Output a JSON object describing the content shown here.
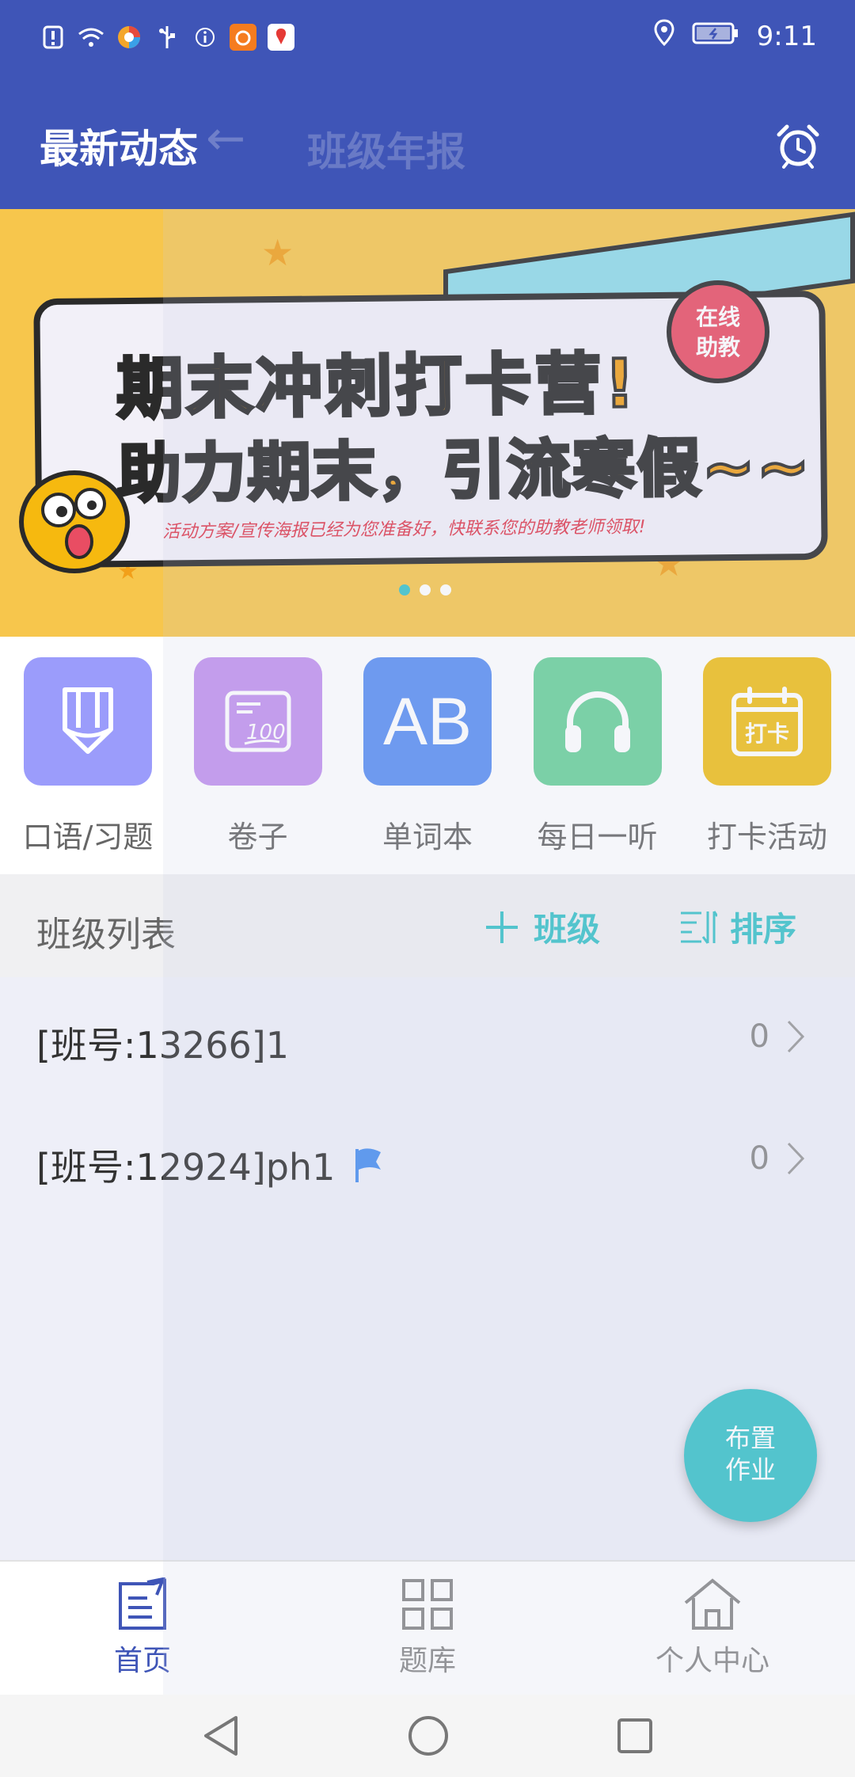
{
  "status_bar": {
    "time": "9:11",
    "left_icons": [
      "alert-icon",
      "wifi-icon",
      "browser-icon",
      "usb-icon",
      "info-icon",
      "uc-app-icon",
      "map-app-icon"
    ],
    "right_icons": [
      "location-icon",
      "battery-icon"
    ]
  },
  "header": {
    "title": "最新动态",
    "ghost_title": "班级年报",
    "alarm_icon": "alarm-clock-icon"
  },
  "banner": {
    "line1": "期末冲刺打卡营!",
    "line2": "助力期末，引流寒假~~",
    "subtitle": "活动方案/宣传海报已经为您准备好，快联系您的助教老师领取!",
    "badge": "在线助教",
    "badge_line1": "在线",
    "badge_line2": "助教",
    "active_dot": 0,
    "dot_count": 3
  },
  "shortcuts": [
    {
      "label": "口语/习题",
      "color": "#9b9cfb",
      "icon": "pencil-icon"
    },
    {
      "label": "卷子",
      "color": "#c293ee",
      "icon": "exam-paper-icon"
    },
    {
      "label": "单词本",
      "color": "#5b8ff2",
      "icon": "ab-letters-icon",
      "icon_text": "AB"
    },
    {
      "label": "每日一听",
      "color": "#6bd19a",
      "icon": "headphones-icon"
    },
    {
      "label": "打卡活动",
      "color": "#f0bf19",
      "icon": "calendar-checkin-icon",
      "icon_text": "打卡"
    }
  ],
  "class_section": {
    "title": "班级列表",
    "add_label": "班级",
    "sort_label": "排序"
  },
  "classes": [
    {
      "name": "[班号:13266]1",
      "count": "0",
      "flag": false
    },
    {
      "name": "[班号:12924]ph1",
      "count": "0",
      "flag": true
    }
  ],
  "fab": {
    "line1": "布置",
    "line2": "作业"
  },
  "tabs": [
    {
      "label": "首页",
      "icon": "home-document-icon",
      "active": true
    },
    {
      "label": "题库",
      "icon": "grid-icon",
      "active": false
    },
    {
      "label": "个人中心",
      "icon": "house-icon",
      "active": false
    }
  ],
  "colors": {
    "primary": "#3f55b7",
    "accent": "#3ac2c9",
    "banner_bg": "#f7c64c"
  }
}
